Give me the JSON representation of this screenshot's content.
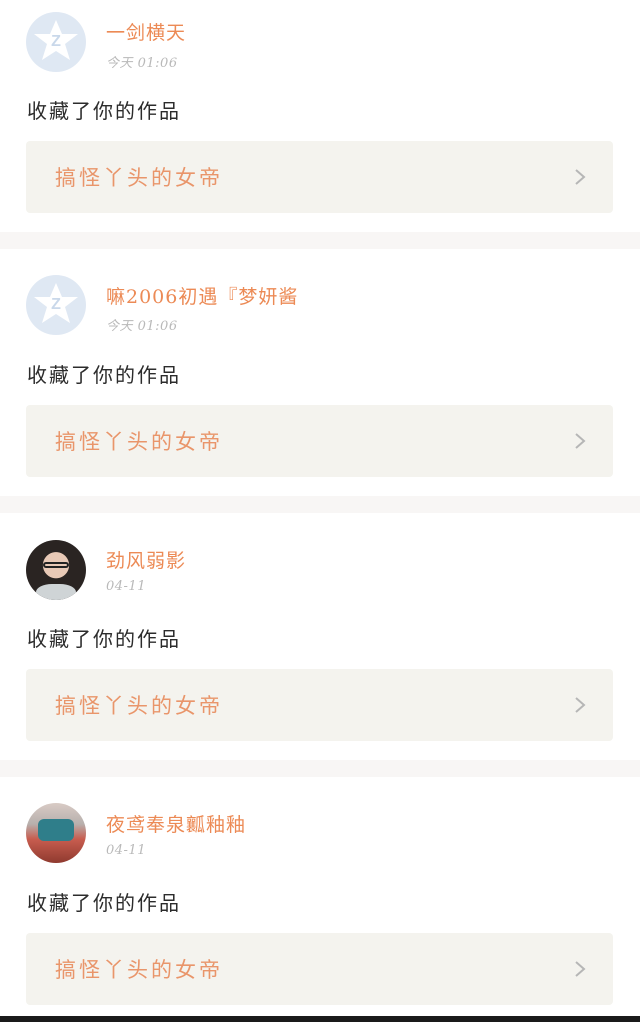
{
  "notifications": [
    {
      "user_name": "一剑横天",
      "time": "今天 01:06",
      "avatar": "default-qq-icon",
      "action_text": "收藏了你的作品",
      "work_title": "搞怪丫头的女帝"
    },
    {
      "user_name": "嘛2006初遇『梦妍酱",
      "time": "今天 01:06",
      "avatar": "default-qq-icon",
      "action_text": "收藏了你的作品",
      "work_title": "搞怪丫头的女帝"
    },
    {
      "user_name": "劲风弱影",
      "time": "04-11",
      "avatar": "user-photo-avatar",
      "action_text": "收藏了你的作品",
      "work_title": "搞怪丫头的女帝"
    },
    {
      "user_name": "夜鸢奉泉瓤釉釉",
      "time": "04-11",
      "avatar": "user-photo-avatar",
      "action_text": "收藏了你的作品",
      "work_title": "搞怪丫头的女帝"
    }
  ],
  "colors": {
    "name_accent": "#ec8a55",
    "work_title": "#e9956a",
    "work_bg": "#f4f3ee",
    "separator": "#f8f6f5"
  },
  "icons": {
    "chevron": "chevron-right-icon",
    "default_avatar": "default-avatar-icon"
  }
}
